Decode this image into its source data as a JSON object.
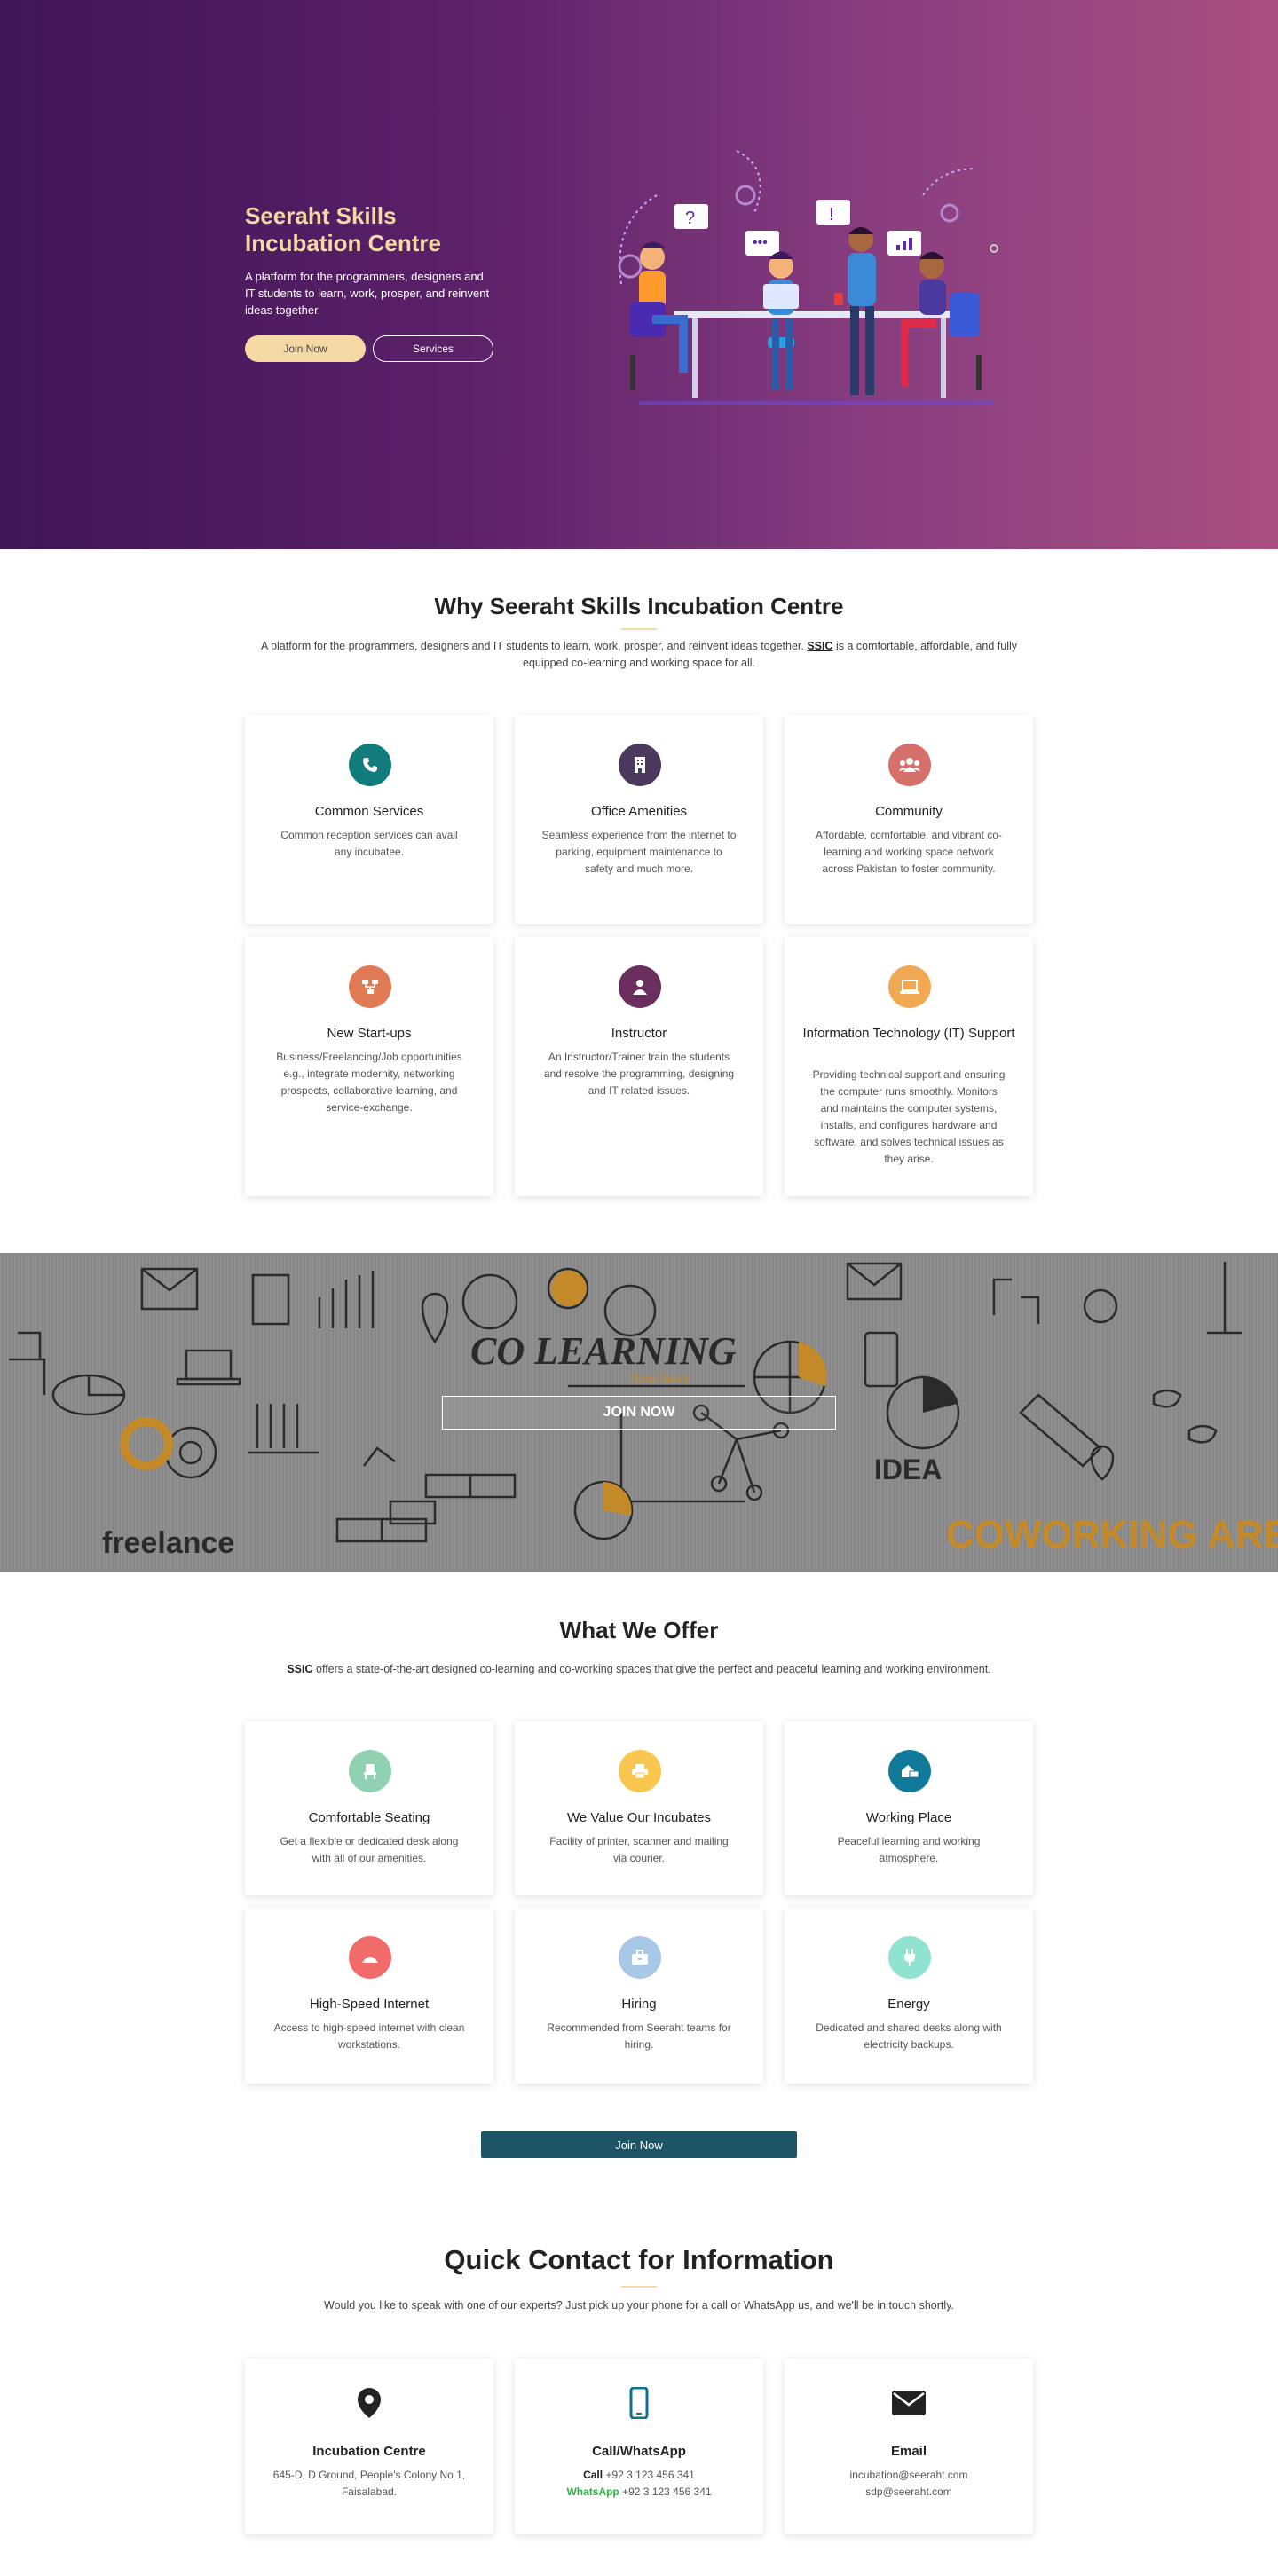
{
  "hero": {
    "title": "Seeraht Skills Incubation Centre",
    "description": "A platform for the programmers, designers and IT students to learn, work, prosper, and reinvent ideas together.",
    "join_label": "Join Now",
    "services_label": "Services"
  },
  "why": {
    "title": "Why Seeraht Skills Incubation Centre",
    "desc_before": "A platform for the programmers, designers and IT students to learn, work, prosper, and reinvent ideas together. ",
    "desc_brand": "SSIC",
    "desc_after": " is a comfortable, affordable, and fully equipped co-learning and working space for all.",
    "cards": [
      {
        "title": "Common Services",
        "text": "Common reception services can avail any incubatee.",
        "icon": "phone-icon",
        "color": "#127c7c"
      },
      {
        "title": "Office Amenities",
        "text": "Seamless experience from the internet to parking, equipment maintenance to safety and much more.",
        "icon": "building-icon",
        "color": "#4b3a5e"
      },
      {
        "title": "Community",
        "text": "Affordable, comfortable, and vibrant co-learning and working space network across Pakistan to foster community.",
        "icon": "users-icon",
        "color": "#d6706a"
      },
      {
        "title": "New Start-ups",
        "text": "Business/Freelancing/Job opportunities e.g., integrate modernity, networking prospects, collaborative learning, and service-exchange.",
        "icon": "sitemap-icon",
        "color": "#e07a55"
      },
      {
        "title": "Instructor",
        "text": "An Instructor/Trainer train the students and resolve the programming, designing and IT related issues.",
        "icon": "instructor-icon",
        "color": "#6a2f5e"
      },
      {
        "title": "Information Technology (IT) Support",
        "text": "Providing technical support and ensuring the computer runs smoothly. Monitors and maintains the computer systems, installs, and configures hardware and software, and solves technical issues as they arise.",
        "icon": "laptop-icon",
        "color": "#f0a952"
      }
    ]
  },
  "banner": {
    "join_label": "JOIN NOW",
    "co_learning": "CO LEARNING",
    "open_space": "Open Space",
    "freelance": "freelance",
    "idea": "IDEA",
    "coworking": "COWORKING ARE"
  },
  "offer": {
    "title": "What We Offer",
    "desc_brand": "SSIC",
    "desc_after": " offers a state-of-the-art designed co-learning and co-working spaces that give the perfect and peaceful learning and working environment.",
    "cards": [
      {
        "title": "Comfortable Seating",
        "text": "Get a flexible or dedicated desk along with all of our amenities.",
        "icon": "chair-icon",
        "color": "#8fd1b0"
      },
      {
        "title": "We Value Our Incubates",
        "text": "Facility of printer, scanner and mailing via courier.",
        "icon": "printer-icon",
        "color": "#f9c74f"
      },
      {
        "title": "Working Place",
        "text": "Peaceful learning and working atmosphere.",
        "icon": "workplace-icon",
        "color": "#117a9a"
      },
      {
        "title": "High-Speed Internet",
        "text": "Access to high-speed internet with clean workstations.",
        "icon": "wifi-icon",
        "color": "#f26b6b"
      },
      {
        "title": "Hiring",
        "text": "Recommended from Seeraht teams for hiring.",
        "icon": "briefcase-icon",
        "color": "#a8c8e8"
      },
      {
        "title": "Energy",
        "text": "Dedicated and shared desks along with electricity backups.",
        "icon": "plug-icon",
        "color": "#8fe3d0"
      }
    ],
    "join_label": "Join Now"
  },
  "contact": {
    "title": "Quick Contact for Information",
    "desc": "Would you like to speak with one of our experts? Just pick up your phone for a call or WhatsApp us, and we'll be in touch shortly.",
    "address_title": "Incubation Centre",
    "address_text": "645-D, D Ground, People's Colony No 1, Faisalabad.",
    "phone_title": "Call/WhatsApp",
    "call_label": "Call",
    "call_number": "+92 3 123 456 341",
    "whatsapp_label": "WhatsApp",
    "whatsapp_number": "+92 3 123 456 341",
    "email_title": "Email",
    "email_1": "incubation@seeraht.com",
    "email_2": "sdp@seeraht.com"
  }
}
